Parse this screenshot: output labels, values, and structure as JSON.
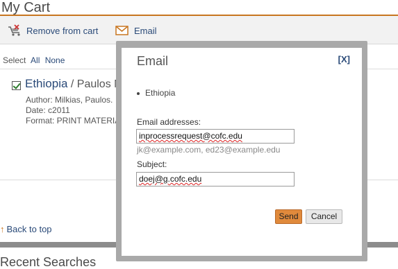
{
  "page": {
    "title": "My Cart",
    "toolbar": {
      "remove_label": "Remove from cart",
      "email_label": "Email"
    },
    "select": {
      "prefix": "Select",
      "all": "All",
      "none": "None"
    },
    "item": {
      "title": "Ethiopia",
      "separator": " / ",
      "author_partial": "Paulos M",
      "author_line": "Author: Milkias, Paulos.",
      "date_line": "Date: c2011",
      "format_line": "Format: PRINT MATERIA",
      "checked": true
    },
    "back_to_top": "Back to top",
    "recent_searches": "Recent Searches"
  },
  "modal": {
    "title": "Email",
    "close": "[X]",
    "items": [
      "Ethiopia"
    ],
    "email_label": "Email addresses:",
    "email_value": "inprocessrequest@cofc.edu",
    "email_hint": "jk@example.com, ed23@example.edu",
    "subject_label": "Subject:",
    "subject_value": "doej@g.cofc.edu",
    "send_label": "Send",
    "cancel_label": "Cancel"
  },
  "colors": {
    "accent": "#c8751f",
    "link": "#2a4a78",
    "send_button": "#e08a3c",
    "modal_frame": "#a9a9a9"
  },
  "icons": {
    "remove": "remove-from-cart-icon",
    "email": "envelope-icon",
    "back_to_top": "arrow-up-icon"
  }
}
